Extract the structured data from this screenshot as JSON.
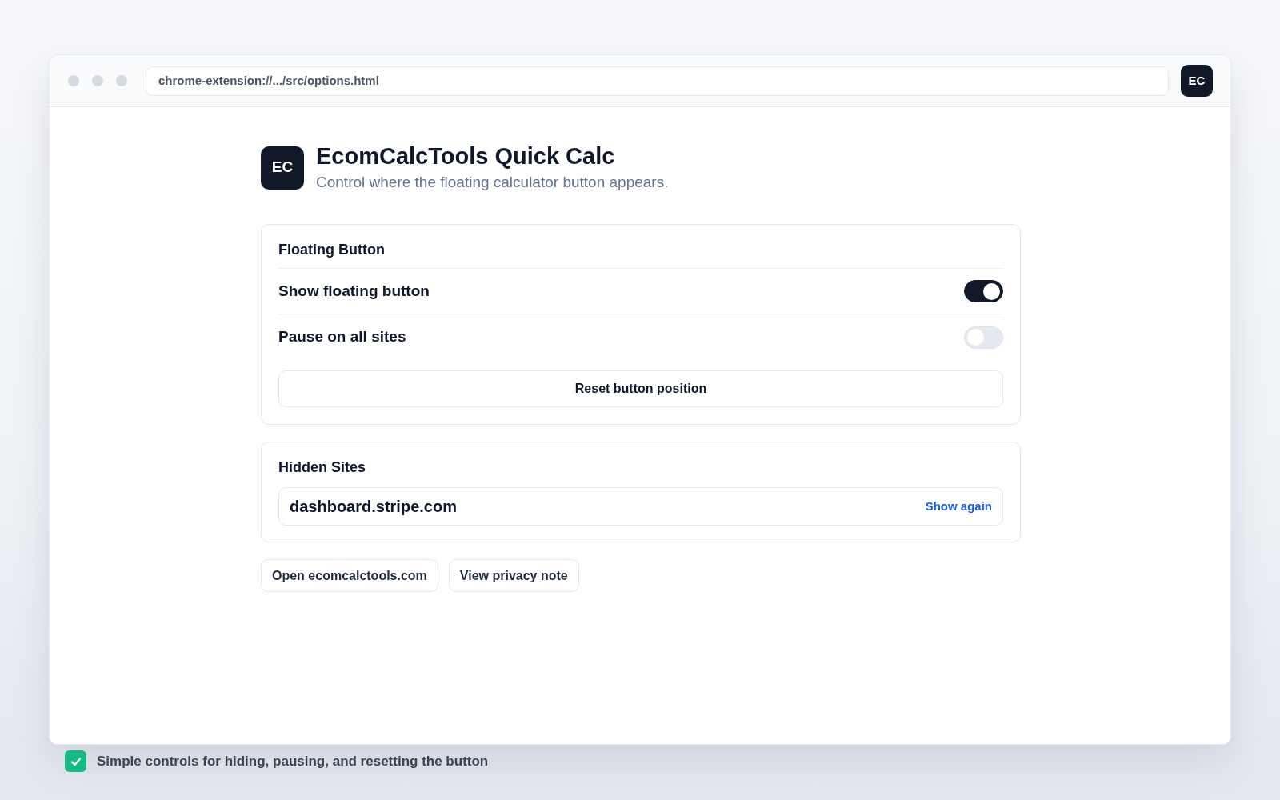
{
  "browser": {
    "url": "chrome-extension://.../src/options.html",
    "badge": "EC"
  },
  "header": {
    "logo": "EC",
    "title": "EcomCalcTools Quick Calc",
    "subtitle": "Control where the floating calculator button appears."
  },
  "floating_button_card": {
    "title": "Floating Button",
    "settings": [
      {
        "label": "Show floating button",
        "on": true
      },
      {
        "label": "Pause on all sites",
        "on": false
      }
    ],
    "reset_button": "Reset button position"
  },
  "hidden_sites_card": {
    "title": "Hidden Sites",
    "sites": [
      {
        "domain": "dashboard.stripe.com",
        "action": "Show again"
      }
    ]
  },
  "links": [
    "Open ecomcalctools.com",
    "View privacy note"
  ],
  "caption": {
    "checked": true,
    "text": "Simple controls for hiding, pausing, and resetting the button"
  }
}
